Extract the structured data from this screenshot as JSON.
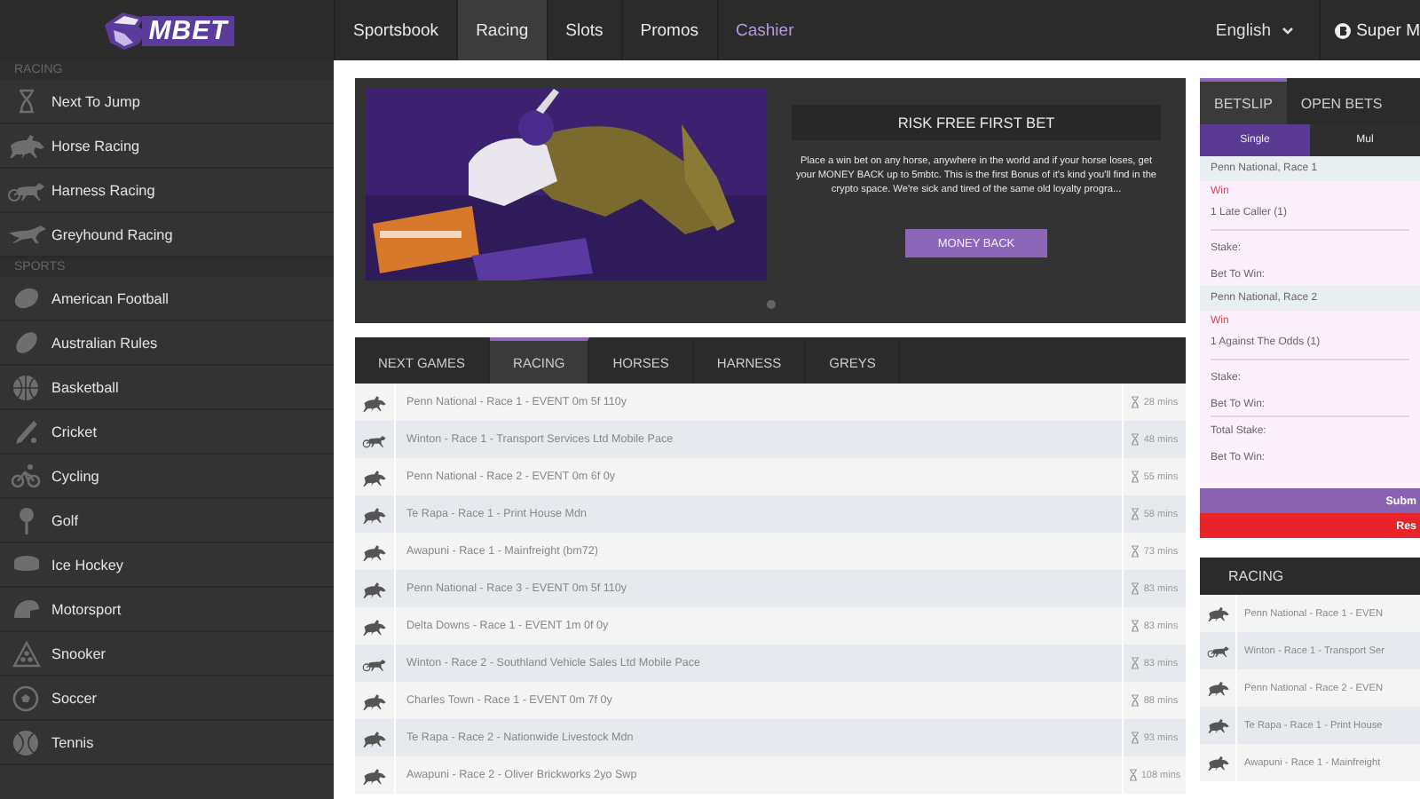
{
  "header": {
    "logo": "MBET",
    "nav": [
      {
        "label": "Sportsbook",
        "selected": false,
        "accent": false
      },
      {
        "label": "Racing",
        "selected": true,
        "accent": false
      },
      {
        "label": "Slots",
        "selected": false,
        "accent": false
      },
      {
        "label": "Promos",
        "selected": false,
        "accent": false
      },
      {
        "label": "Cashier",
        "selected": false,
        "accent": true
      }
    ],
    "language": "English",
    "account": "Super M"
  },
  "sidebar": {
    "sections": [
      {
        "title": "RACING",
        "items": [
          {
            "label": "Next To Jump"
          },
          {
            "label": "Horse Racing"
          },
          {
            "label": "Harness Racing"
          },
          {
            "label": "Greyhound Racing"
          }
        ]
      },
      {
        "title": "SPORTS",
        "items": [
          {
            "label": "American Football"
          },
          {
            "label": "Australian Rules"
          },
          {
            "label": "Basketball"
          },
          {
            "label": "Cricket"
          },
          {
            "label": "Cycling"
          },
          {
            "label": "Golf"
          },
          {
            "label": "Ice Hockey"
          },
          {
            "label": "Motorsport"
          },
          {
            "label": "Snooker"
          },
          {
            "label": "Soccer"
          },
          {
            "label": "Tennis"
          }
        ]
      }
    ]
  },
  "banner": {
    "kind": "picture",
    "title": "RISK FREE FIRST BET",
    "text": "Place a win bet on any horse, anywhere in the world and if your horse loses, get your MONEY BACK up to 5mbtc. This is the first Bonus of it's kind you'll find in the crypto space. We're sick and tired of the same old loyalty progra...",
    "button": "MONEY BACK"
  },
  "races": {
    "tabs": [
      {
        "label": "NEXT GAMES",
        "selected": false
      },
      {
        "label": "RACING",
        "selected": true
      },
      {
        "label": "HORSES",
        "selected": false
      },
      {
        "label": "HARNESS",
        "selected": false
      },
      {
        "label": "GREYS",
        "selected": false
      }
    ],
    "rows": [
      {
        "kind": "horse",
        "name": "Penn National - Race 1 - EVENT 0m 5f 110y",
        "time": "28 mins"
      },
      {
        "kind": "harness",
        "name": "Winton - Race 1 - Transport Services Ltd Mobile Pace",
        "time": "48 mins"
      },
      {
        "kind": "horse",
        "name": "Penn National - Race 2 - EVENT 0m 6f 0y",
        "time": "55 mins"
      },
      {
        "kind": "horse",
        "name": "Te Rapa - Race 1 - Print House Mdn",
        "time": "58 mins"
      },
      {
        "kind": "horse",
        "name": "Awapuni - Race 1 - Mainfreight (bm72)",
        "time": "73 mins"
      },
      {
        "kind": "horse",
        "name": "Penn National - Race 3 - EVENT 0m 5f 110y",
        "time": "83 mins"
      },
      {
        "kind": "horse",
        "name": "Delta Downs - Race 1 - EVENT 1m 0f 0y",
        "time": "83 mins"
      },
      {
        "kind": "harness",
        "name": "Winton - Race 2 - Southland Vehicle Sales Ltd Mobile Pace",
        "time": "83 mins"
      },
      {
        "kind": "horse",
        "name": "Charles Town - Race 1 - EVENT 0m 7f 0y",
        "time": "88 mins"
      },
      {
        "kind": "horse",
        "name": "Te Rapa - Race 2 - Nationwide Livestock Mdn",
        "time": "93 mins"
      },
      {
        "kind": "horse",
        "name": "Awapuni - Race 2 - Oliver Brickworks 2yo Swp",
        "time": "108 mins"
      }
    ]
  },
  "betslip": {
    "tabs": [
      {
        "label": "BETSLIP",
        "selected": true
      },
      {
        "label": "OPEN BETS",
        "selected": false
      }
    ],
    "modes": [
      {
        "label": "Single",
        "selected": true
      },
      {
        "label": "Mul",
        "selected": false
      }
    ],
    "bets": [
      {
        "event": "Penn National, Race 1",
        "market": "Win",
        "selection": "1 Late Caller (1)",
        "stake": "Stake:",
        "to_win": "Bet To Win:"
      },
      {
        "event": "Penn National, Race 2",
        "market": "Win",
        "selection": "1 Against The Odds (1)",
        "stake": "Stake:",
        "to_win": "Bet To Win:"
      }
    ],
    "total_stake": "Total Stake:",
    "total_to_win": "Bet To Win:",
    "submit": "Subm",
    "reset": "Res"
  },
  "racing_panel": {
    "title": "RACING",
    "rows": [
      {
        "kind": "horse",
        "name": "Penn National - Race 1 - EVEN"
      },
      {
        "kind": "harness",
        "name": "Winton - Race 1 - Transport Ser"
      },
      {
        "kind": "horse",
        "name": "Penn National - Race 2 - EVEN"
      },
      {
        "kind": "horse",
        "name": "Te Rapa - Race 1 - Print House"
      },
      {
        "kind": "horse",
        "name": "Awapuni - Race 1 - Mainfreight"
      }
    ]
  }
}
